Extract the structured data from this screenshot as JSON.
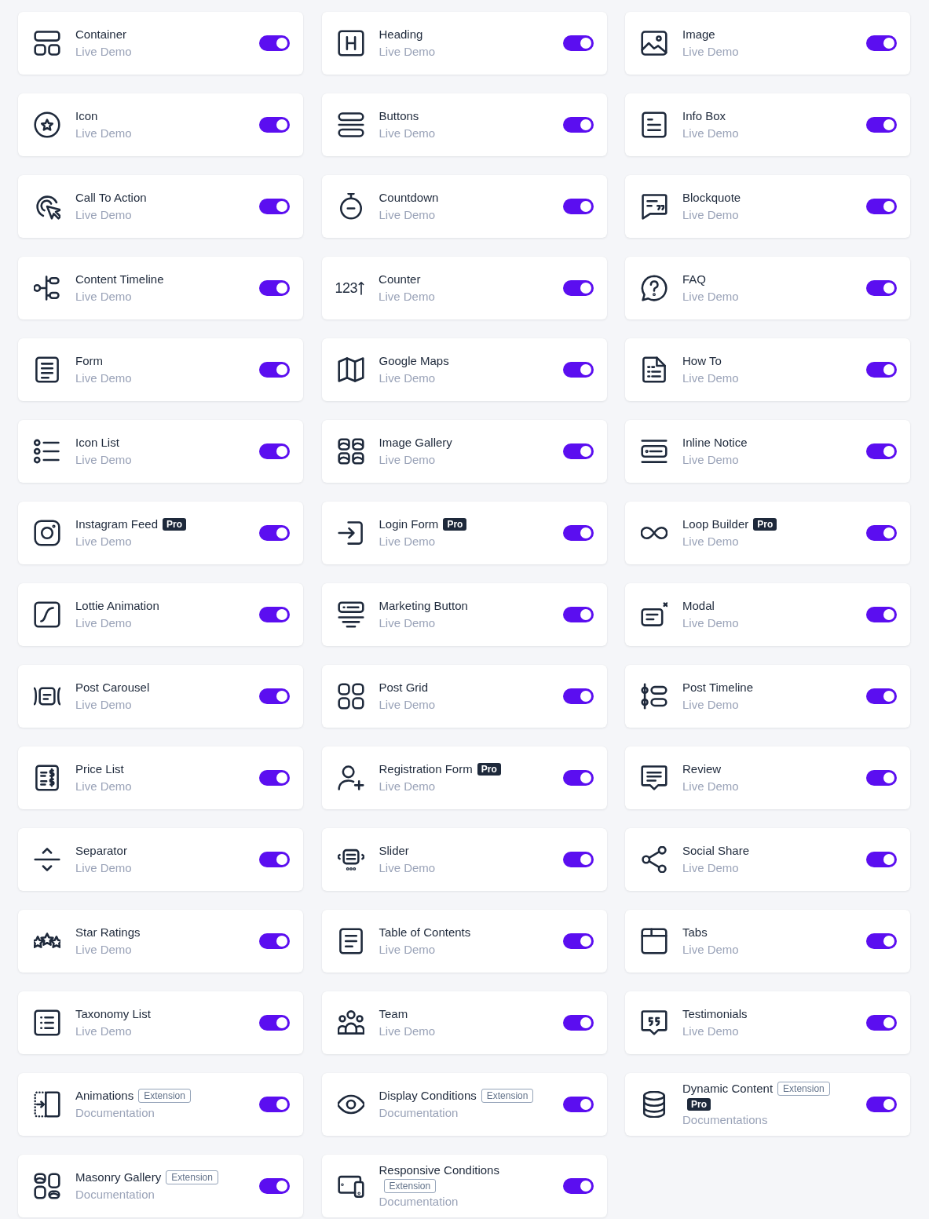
{
  "widgets": [
    {
      "title": "Container",
      "link": "Live Demo",
      "on": true
    },
    {
      "title": "Heading",
      "link": "Live Demo",
      "on": true
    },
    {
      "title": "Image",
      "link": "Live Demo",
      "on": true
    },
    {
      "title": "Icon",
      "link": "Live Demo",
      "on": true
    },
    {
      "title": "Buttons",
      "link": "Live Demo",
      "on": true
    },
    {
      "title": "Info Box",
      "link": "Live Demo",
      "on": true
    },
    {
      "title": "Call To Action",
      "link": "Live Demo",
      "on": true
    },
    {
      "title": "Countdown",
      "link": "Live Demo",
      "on": true
    },
    {
      "title": "Blockquote",
      "link": "Live Demo",
      "on": true
    },
    {
      "title": "Content Timeline",
      "link": "Live Demo",
      "on": true
    },
    {
      "title": "Counter",
      "link": "Live Demo",
      "on": true,
      "icon_text": "123"
    },
    {
      "title": "FAQ",
      "link": "Live Demo",
      "on": true
    },
    {
      "title": "Form",
      "link": "Live Demo",
      "on": true
    },
    {
      "title": "Google Maps",
      "link": "Live Demo",
      "on": true
    },
    {
      "title": "How To",
      "link": "Live Demo",
      "on": true
    },
    {
      "title": "Icon List",
      "link": "Live Demo",
      "on": true
    },
    {
      "title": "Image Gallery",
      "link": "Live Demo",
      "on": true
    },
    {
      "title": "Inline Notice",
      "link": "Live Demo",
      "on": true
    },
    {
      "title": "Instagram Feed",
      "link": "Live Demo",
      "on": true,
      "badges": [
        {
          "kind": "pro",
          "label": "Pro"
        }
      ]
    },
    {
      "title": "Login Form",
      "link": "Live Demo",
      "on": true,
      "badges": [
        {
          "kind": "pro",
          "label": "Pro"
        }
      ]
    },
    {
      "title": "Loop Builder",
      "link": "Live Demo",
      "on": true,
      "badges": [
        {
          "kind": "pro",
          "label": "Pro"
        }
      ]
    },
    {
      "title": "Lottie Animation",
      "link": "Live Demo",
      "on": true
    },
    {
      "title": "Marketing Button",
      "link": "Live Demo",
      "on": true
    },
    {
      "title": "Modal",
      "link": "Live Demo",
      "on": true
    },
    {
      "title": "Post Carousel",
      "link": "Live Demo",
      "on": true
    },
    {
      "title": "Post Grid",
      "link": "Live Demo",
      "on": true
    },
    {
      "title": "Post Timeline",
      "link": "Live Demo",
      "on": true
    },
    {
      "title": "Price List",
      "link": "Live Demo",
      "on": true
    },
    {
      "title": "Registration Form",
      "link": "Live Demo",
      "on": true,
      "badges": [
        {
          "kind": "pro",
          "label": "Pro"
        }
      ]
    },
    {
      "title": "Review",
      "link": "Live Demo",
      "on": true
    },
    {
      "title": "Separator",
      "link": "Live Demo",
      "on": true
    },
    {
      "title": "Slider",
      "link": "Live Demo",
      "on": true
    },
    {
      "title": "Social Share",
      "link": "Live Demo",
      "on": true
    },
    {
      "title": "Star Ratings",
      "link": "Live Demo",
      "on": true
    },
    {
      "title": "Table of Contents",
      "link": "Live Demo",
      "on": true
    },
    {
      "title": "Tabs",
      "link": "Live Demo",
      "on": true
    },
    {
      "title": "Taxonomy List",
      "link": "Live Demo",
      "on": true
    },
    {
      "title": "Team",
      "link": "Live Demo",
      "on": true
    },
    {
      "title": "Testimonials",
      "link": "Live Demo",
      "on": true
    },
    {
      "title": "Animations",
      "link": "Documentation",
      "on": true,
      "badges": [
        {
          "kind": "extension",
          "label": "Extension"
        }
      ]
    },
    {
      "title": "Display Conditions",
      "link": "Documentation",
      "on": true,
      "badges": [
        {
          "kind": "extension",
          "label": "Extension"
        }
      ]
    },
    {
      "title": "Dynamic Content",
      "link": "Documentations",
      "on": true,
      "badges": [
        {
          "kind": "extension",
          "label": "Extension"
        },
        {
          "kind": "pro",
          "label": "Pro"
        }
      ]
    },
    {
      "title": "Masonry Gallery",
      "link": "Documentation",
      "on": true,
      "badges": [
        {
          "kind": "extension",
          "label": "Extension"
        }
      ]
    },
    {
      "title": "Responsive Conditions",
      "link": "Documentation",
      "on": true,
      "badges": [
        {
          "kind": "extension",
          "label": "Extension"
        }
      ]
    }
  ]
}
